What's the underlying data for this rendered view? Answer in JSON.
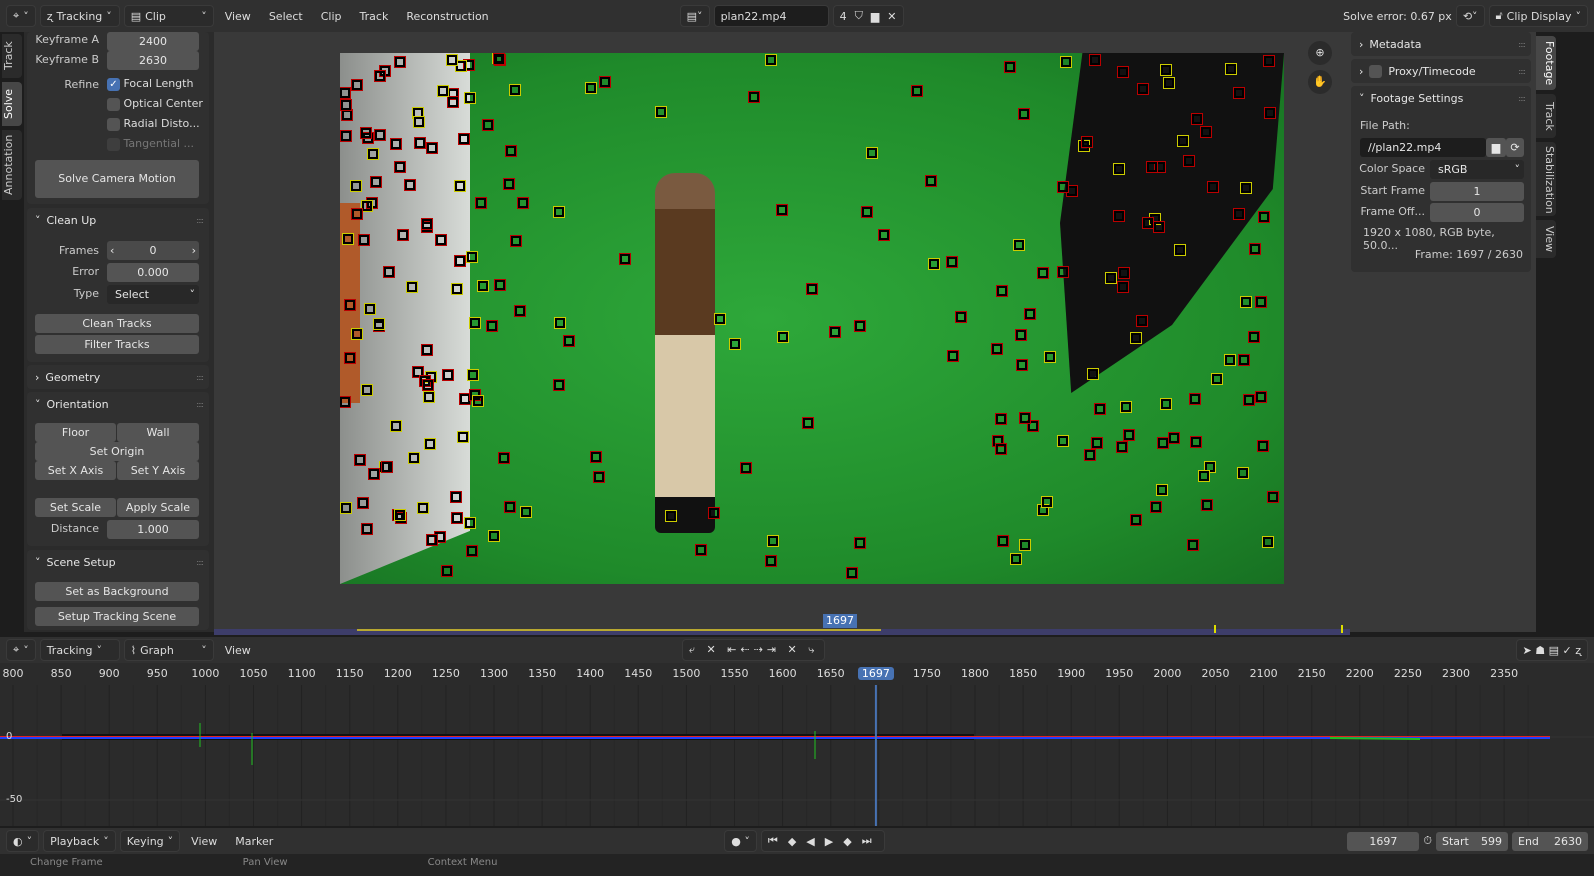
{
  "top_bar": {
    "editor_type_icon": "crosshair-icon",
    "workspace": "Tracking",
    "view_mode": "Clip",
    "menus": [
      "View",
      "Select",
      "Clip",
      "Track",
      "Reconstruction"
    ],
    "clip_name": "plan22.mp4",
    "users": "4",
    "solve_error": "Solve error: 0.67 px",
    "display": "Clip Display"
  },
  "left_tabs": [
    "Track",
    "Solve",
    "Annotation"
  ],
  "solve": {
    "keyframe_a_label": "Keyframe A",
    "keyframe_a": "2400",
    "keyframe_b_label": "Keyframe B",
    "keyframe_b": "2630",
    "refine_label": "Refine",
    "refine": [
      {
        "label": "Focal Length",
        "checked": true
      },
      {
        "label": "Optical Center",
        "checked": false
      },
      {
        "label": "Radial Disto...",
        "checked": false
      },
      {
        "label": "Tangential ...",
        "checked": false
      }
    ],
    "solve_button": "Solve Camera Motion"
  },
  "cleanup": {
    "title": "Clean Up",
    "frames_label": "Frames",
    "frames": "0",
    "error_label": "Error",
    "error": "0.000",
    "type_label": "Type",
    "type": "Select",
    "clean_button": "Clean Tracks",
    "filter_button": "Filter Tracks"
  },
  "geometry": {
    "title": "Geometry"
  },
  "orientation": {
    "title": "Orientation",
    "floor": "Floor",
    "wall": "Wall",
    "set_origin": "Set Origin",
    "set_x": "Set X Axis",
    "set_y": "Set Y Axis",
    "set_scale": "Set Scale",
    "apply_scale": "Apply Scale",
    "distance_label": "Distance",
    "distance": "1.000"
  },
  "scene_setup": {
    "title": "Scene Setup",
    "background": "Set as Background",
    "tracking_scene": "Setup Tracking Scene"
  },
  "right_panel": {
    "metadata": "Metadata",
    "proxy": "Proxy/Timecode",
    "footage_settings": "Footage Settings",
    "file_path_label": "File Path:",
    "file_path": "//plan22.mp4",
    "color_space_label": "Color Space",
    "color_space": "sRGB",
    "start_frame_label": "Start Frame",
    "start_frame": "1",
    "frame_offset_label": "Frame Off...",
    "frame_offset": "0",
    "info": "1920 x 1080, RGB byte, 50.0...",
    "frame_info": "Frame: 1697 / 2630"
  },
  "right_tabs": [
    "Footage",
    "Track",
    "Stabilization",
    "View"
  ],
  "scrubber": {
    "current_frame": "1697"
  },
  "graph_header": {
    "workspace": "Tracking",
    "view": "Graph",
    "menus": [
      "View"
    ]
  },
  "graph": {
    "x_ticks": [
      "800",
      "850",
      "900",
      "950",
      "1000",
      "1050",
      "1100",
      "1150",
      "1200",
      "1250",
      "1300",
      "1350",
      "1400",
      "1450",
      "1500",
      "1550",
      "1600",
      "1650",
      "1697",
      "1750",
      "1800",
      "1850",
      "1900",
      "1950",
      "2000",
      "2050",
      "2100",
      "2150",
      "2200",
      "2250",
      "2300",
      "2350"
    ],
    "y_ticks": [
      "0",
      "-50"
    ],
    "current_frame": 1697,
    "colors": {
      "x": "#e02020",
      "y": "#20c020",
      "error": "#2040ff"
    }
  },
  "timeline": {
    "menus": [
      "Playback",
      "Keying",
      "View",
      "Marker"
    ],
    "current_frame": "1697",
    "start_label": "Start",
    "start": "599",
    "end_label": "End",
    "end": "2630"
  },
  "status_bar": [
    "Change Frame",
    "Pan View",
    "Context Menu"
  ]
}
